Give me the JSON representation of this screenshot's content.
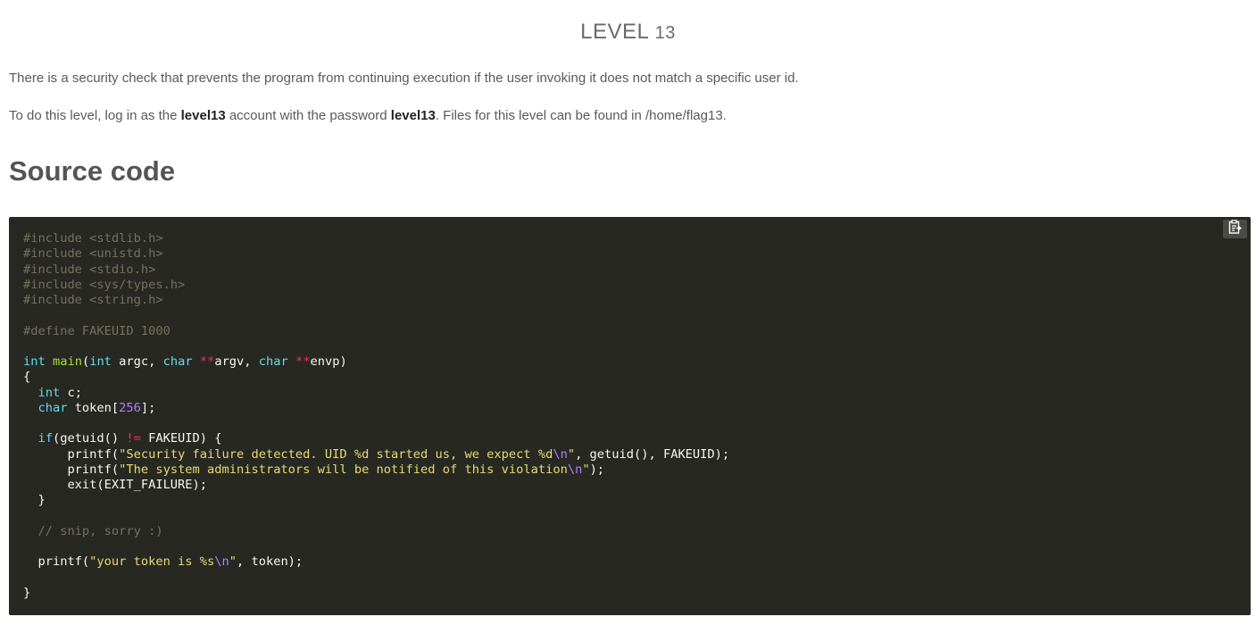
{
  "header": {
    "title_word": "LEVEL",
    "title_number": "13"
  },
  "intro": {
    "paragraph1": "There is a security check that prevents the program from continuing execution if the user invoking it does not match a specific user id.",
    "p2_before_account": "To do this level, log in as the ",
    "account": "level13",
    "p2_middle": " account with the password ",
    "password": "level13",
    "p2_after_password": ". Files for this level can be found in /home/flag13."
  },
  "section": {
    "heading": "Source code"
  },
  "code": {
    "copy_icon": "clipboard-icon",
    "lines": [
      [
        {
          "t": "cm",
          "v": "#include <stdlib.h>"
        }
      ],
      [
        {
          "t": "cm",
          "v": "#include <unistd.h>"
        }
      ],
      [
        {
          "t": "cm",
          "v": "#include <stdio.h>"
        }
      ],
      [
        {
          "t": "cm",
          "v": "#include <sys/types.h>"
        }
      ],
      [
        {
          "t": "cm",
          "v": "#include <string.h>"
        }
      ],
      [],
      [
        {
          "t": "cm",
          "v": "#define FAKEUID 1000"
        }
      ],
      [],
      [
        {
          "t": "kt",
          "v": "int"
        },
        {
          "t": "",
          "v": " "
        },
        {
          "t": "fn",
          "v": "main"
        },
        {
          "t": "",
          "v": "("
        },
        {
          "t": "kt",
          "v": "int"
        },
        {
          "t": "",
          "v": " argc, "
        },
        {
          "t": "kt",
          "v": "char"
        },
        {
          "t": "",
          "v": " "
        },
        {
          "t": "op",
          "v": "**"
        },
        {
          "t": "",
          "v": "argv, "
        },
        {
          "t": "kt",
          "v": "char"
        },
        {
          "t": "",
          "v": " "
        },
        {
          "t": "op",
          "v": "**"
        },
        {
          "t": "",
          "v": "envp)"
        }
      ],
      [
        {
          "t": "",
          "v": "{"
        }
      ],
      [
        {
          "t": "",
          "v": "  "
        },
        {
          "t": "kt",
          "v": "int"
        },
        {
          "t": "",
          "v": " c;"
        }
      ],
      [
        {
          "t": "",
          "v": "  "
        },
        {
          "t": "kt",
          "v": "char"
        },
        {
          "t": "",
          "v": " token["
        },
        {
          "t": "nb",
          "v": "256"
        },
        {
          "t": "",
          "v": "];"
        }
      ],
      [],
      [
        {
          "t": "",
          "v": "  "
        },
        {
          "t": "kt",
          "v": "if"
        },
        {
          "t": "",
          "v": "(getuid() "
        },
        {
          "t": "op",
          "v": "!="
        },
        {
          "t": "",
          "v": " FAKEUID) {"
        }
      ],
      [
        {
          "t": "",
          "v": "      printf("
        },
        {
          "t": "st",
          "v": "\"Security failure detected. UID %d started us, we expect %d"
        },
        {
          "t": "nb",
          "v": "\\n"
        },
        {
          "t": "st",
          "v": "\""
        },
        {
          "t": "",
          "v": ", getuid(), FAKEUID);"
        }
      ],
      [
        {
          "t": "",
          "v": "      printf("
        },
        {
          "t": "st",
          "v": "\"The system administrators will be notified of this violation"
        },
        {
          "t": "nb",
          "v": "\\n"
        },
        {
          "t": "st",
          "v": "\""
        },
        {
          "t": "",
          "v": ");"
        }
      ],
      [
        {
          "t": "",
          "v": "      exit(EXIT_FAILURE);"
        }
      ],
      [
        {
          "t": "",
          "v": "  }"
        }
      ],
      [],
      [
        {
          "t": "",
          "v": "  "
        },
        {
          "t": "cm",
          "v": "// snip, sorry :)"
        }
      ],
      [],
      [
        {
          "t": "",
          "v": "  printf("
        },
        {
          "t": "st",
          "v": "\"your token is %s"
        },
        {
          "t": "nb",
          "v": "\\n"
        },
        {
          "t": "st",
          "v": "\""
        },
        {
          "t": "",
          "v": ", token);"
        }
      ],
      [],
      [
        {
          "t": "",
          "v": "}"
        }
      ]
    ]
  }
}
